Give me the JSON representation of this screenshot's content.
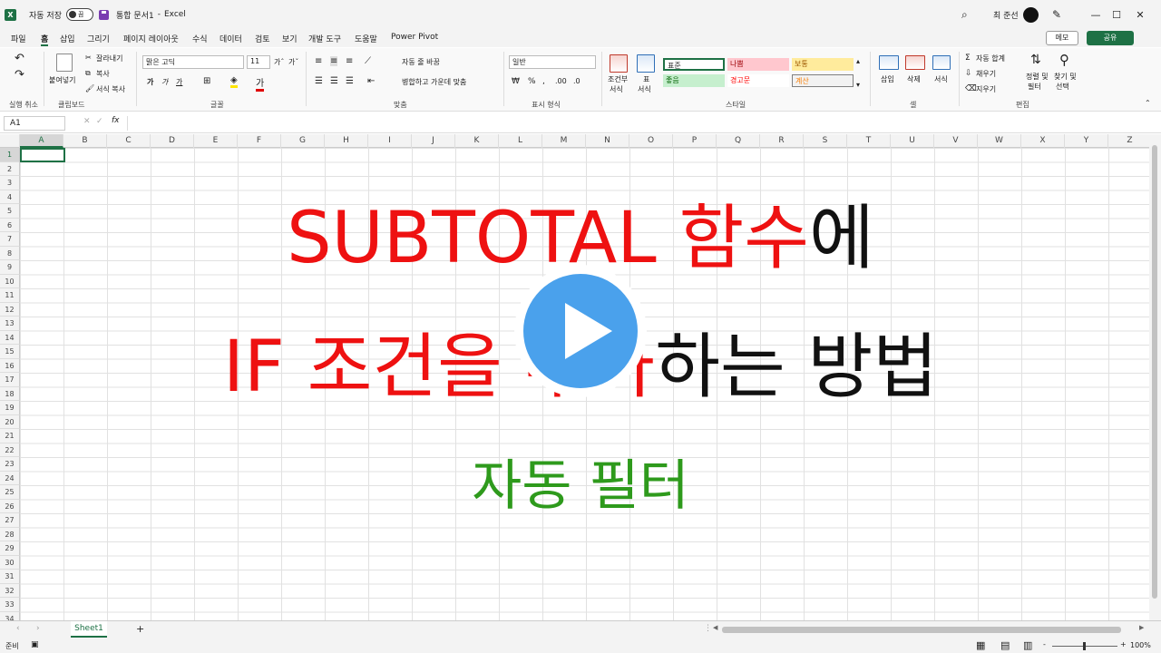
{
  "titlebar": {
    "autosave_label": "자동 저장",
    "autosave_state": "끔",
    "doc_name": "통합 문서1",
    "dash": "-",
    "app_name": "Excel",
    "user_name": "최 준선",
    "minimize": "—",
    "restore": "☐",
    "close": "✕",
    "search_icon": "⌕",
    "pen_icon": "✎"
  },
  "menu": {
    "items": [
      "파일",
      "홈",
      "삽입",
      "그리기",
      "페이지 레이아웃",
      "수식",
      "데이터",
      "검토",
      "보기",
      "개발 도구",
      "도움말",
      "Power Pivot"
    ],
    "memo": "메모",
    "share": "공유"
  },
  "ribbon": {
    "undo_group": "실행 취소",
    "clipboard": {
      "paste": "붙여넣기",
      "cut": "잘라내기",
      "copy": "복사",
      "format_painter": "서식 복사",
      "label": "클립보드"
    },
    "font": {
      "name": "맑은 고딕",
      "size": "11",
      "grow": "가ˆ",
      "shrink": "가ˇ",
      "bold": "가",
      "italic": "가",
      "underline": "가",
      "label": "글꼴"
    },
    "align": {
      "wrap": "자동 줄 바꿈",
      "merge": "병합하고 가운데 맞춤",
      "label": "맞춤"
    },
    "number": {
      "format": "일반",
      "label": "표시 형식"
    },
    "styles": {
      "cond_format": "조건부",
      "cond_format2": "서식",
      "table": "표",
      "table2": "서식",
      "cells": [
        "표준",
        "나쁨",
        "보통",
        "좋음",
        "경고문",
        "계산"
      ],
      "label": "스타일"
    },
    "cells": {
      "insert": "삽입",
      "delete": "삭제",
      "format": "서식",
      "label": "셀"
    },
    "editing": {
      "autosum": "자동 합계",
      "fill": "채우기",
      "clear": "지우기",
      "sort": "정렬 및",
      "sort2": "필터",
      "find": "찾기 및",
      "find2": "선택",
      "label": "편집"
    }
  },
  "formula": {
    "namebox": "A1",
    "fx": "fx",
    "cancel": "✕",
    "enter": "✓"
  },
  "grid": {
    "columns": [
      "A",
      "B",
      "C",
      "D",
      "E",
      "F",
      "G",
      "H",
      "I",
      "J",
      "K",
      "L",
      "M",
      "N",
      "O",
      "P",
      "Q",
      "R",
      "S",
      "T",
      "U",
      "V",
      "W",
      "X",
      "Y",
      "Z"
    ],
    "rows": [
      "1",
      "2",
      "3",
      "4",
      "5",
      "6",
      "7",
      "8",
      "9",
      "10",
      "11",
      "12",
      "13",
      "14",
      "15",
      "16",
      "17",
      "18",
      "19",
      "20",
      "21",
      "22",
      "23",
      "24",
      "25",
      "26",
      "27",
      "28",
      "29",
      "30",
      "31",
      "32",
      "33",
      "34"
    ]
  },
  "overlay": {
    "line1_red": "SUBTOTAL 함수",
    "line1_black": "에",
    "line2_red": "IF 조건을 추가",
    "line2_black": "하는 방법",
    "line3": "자동 필터",
    "colors": {
      "red": "#ee1111",
      "black": "#111111",
      "green": "#2e9a1c",
      "play": "#4aa1ec"
    }
  },
  "sheets": {
    "tabs": [
      "Sheet1"
    ],
    "add": "+"
  },
  "status": {
    "ready": "준비",
    "zoom": "100%",
    "minus": "-",
    "plus": "+"
  }
}
